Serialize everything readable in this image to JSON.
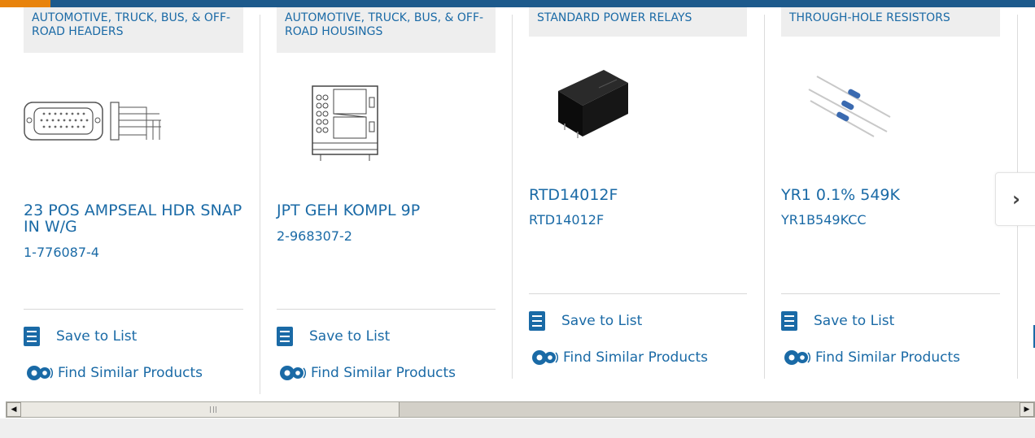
{
  "carousel": {
    "cards": [
      {
        "category": "AUTOMOTIVE, TRUCK, BUS, & OFF-ROAD HEADERS",
        "title": "23 POS AMPSEAL HDR SNAP IN W/G",
        "part_number": "1-776087-4",
        "image_icon": "connector-header-icon"
      },
      {
        "category": "AUTOMOTIVE, TRUCK, BUS, & OFF-ROAD HOUSINGS",
        "title": "JPT GEH KOMPL 9P",
        "part_number": "2-968307-2",
        "image_icon": "connector-housing-icon"
      },
      {
        "category": "STANDARD POWER RELAYS",
        "title": "RTD14012F",
        "part_number": "RTD14012F",
        "image_icon": "relay-icon"
      },
      {
        "category": "THROUGH-HOLE RESISTORS",
        "title": "YR1 0.1% 549K",
        "part_number": "YR1B549KCC",
        "image_icon": "resistor-icon"
      }
    ],
    "save_label": "Save to List",
    "similar_label": "Find Similar Products",
    "next_label": "›"
  },
  "colors": {
    "link": "#1a6aa6",
    "topbar": "#1d5a8c",
    "accent": "#e8830c"
  }
}
